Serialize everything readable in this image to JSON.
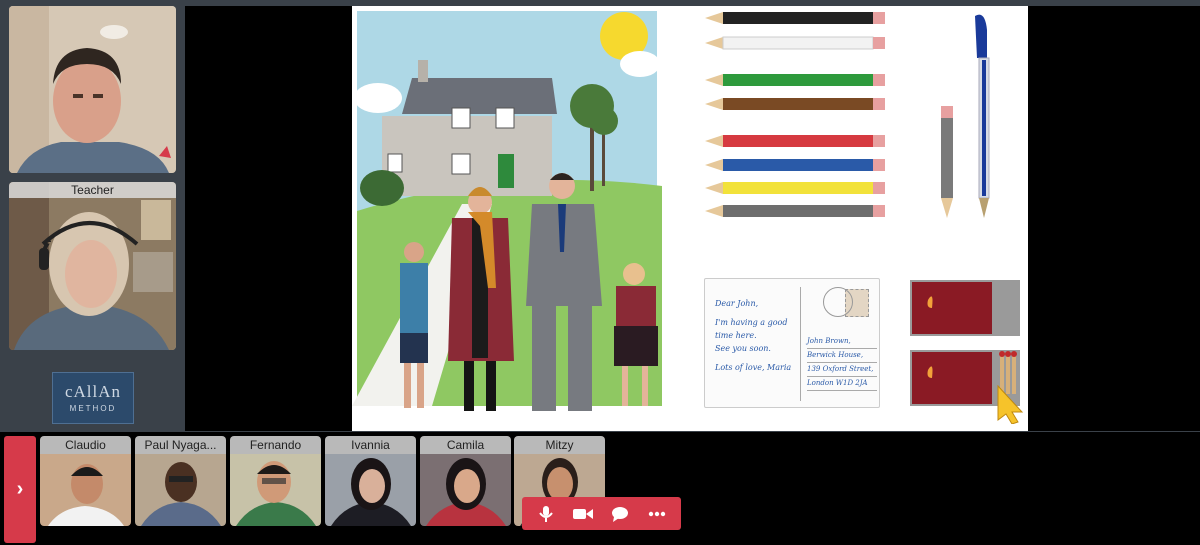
{
  "tiles": {
    "teacher_label": "Teacher"
  },
  "logo": {
    "line1": "cAllAn",
    "line2": "METHOD"
  },
  "slide": {
    "postcard": {
      "greeting": "Dear John,",
      "line1": "I'm having a good",
      "line2": "time here.",
      "line3": "See you soon.",
      "signoff": "Lots of love, Maria",
      "addr1": "John Brown,",
      "addr2": "Berwick House,",
      "addr3": "139 Oxford Street,",
      "addr4": "London W1D 2JA"
    }
  },
  "participants": [
    {
      "name": "Claudio",
      "bg": "#c9a88a",
      "shirt": "#f2f2f2"
    },
    {
      "name": "Paul Nyaga...",
      "bg": "#b7a690",
      "shirt": "#5a6b8a"
    },
    {
      "name": "Fernando",
      "bg": "#c7c2a8",
      "shirt": "#3a7a4a"
    },
    {
      "name": "Ivannia",
      "bg": "#9aa0a8",
      "shirt": "#1d1d24"
    },
    {
      "name": "Camila",
      "bg": "#7b6f72",
      "shirt": "#b8333f"
    },
    {
      "name": "Mitzy",
      "bg": "#bda892",
      "shirt": "#2a2226"
    }
  ],
  "icons": {
    "toggle": "chevron-right-icon",
    "mic": "microphone-icon",
    "camera": "video-camera-icon",
    "chat": "chat-bubble-icon",
    "more": "more-dots-icon"
  },
  "colors": {
    "accent": "#d63a4a",
    "background": "#3a4149",
    "stage": "#000000"
  }
}
